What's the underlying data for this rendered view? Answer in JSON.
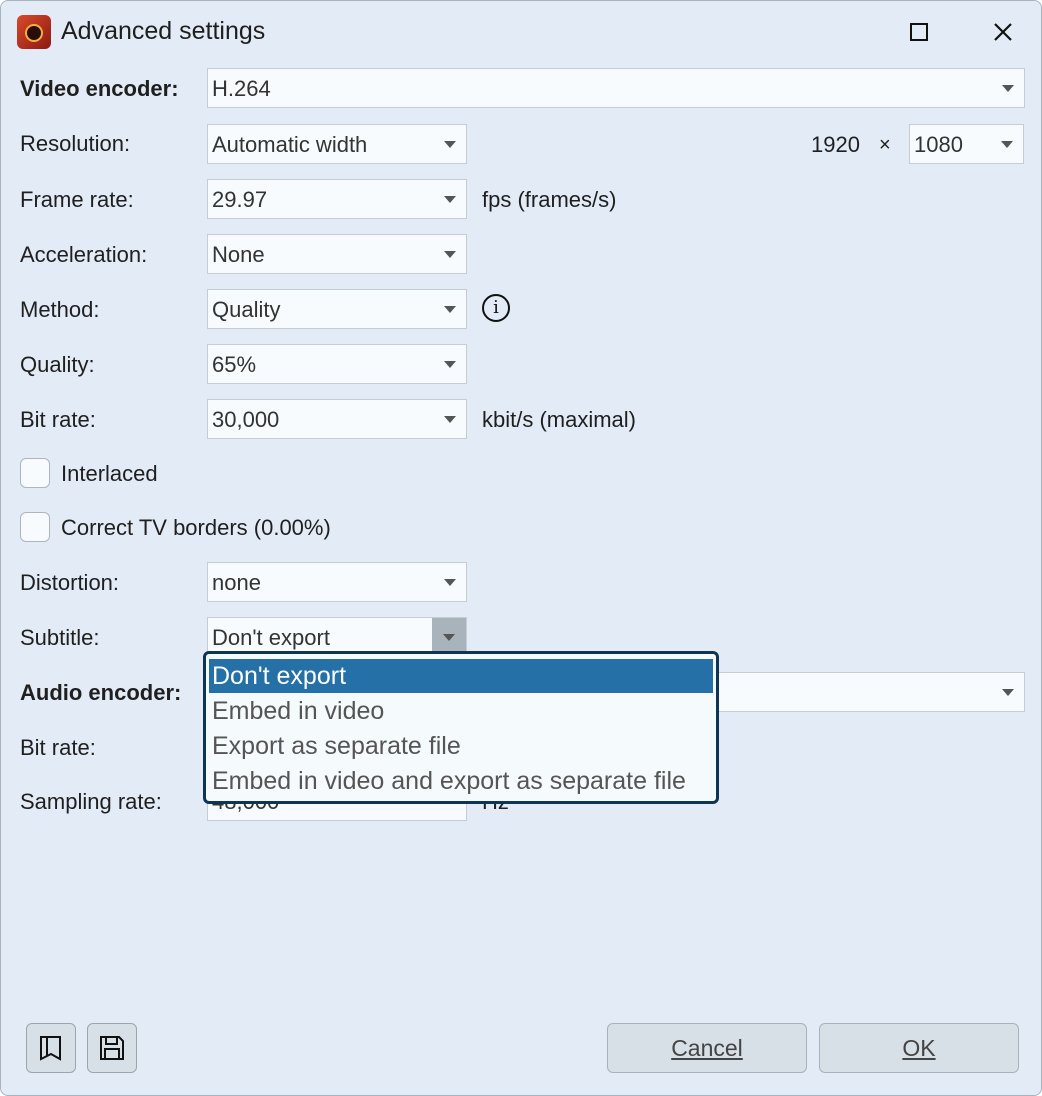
{
  "window": {
    "title": "Advanced settings"
  },
  "video": {
    "encoder_label": "Video encoder:",
    "encoder_value": "H.264",
    "resolution_label": "Resolution:",
    "resolution_value": "Automatic width",
    "width_value": "1920",
    "times": "×",
    "height_value": "1080",
    "framerate_label": "Frame rate:",
    "framerate_value": "29.97",
    "framerate_unit": "fps (frames/s)",
    "acceleration_label": "Acceleration:",
    "acceleration_value": "None",
    "method_label": "Method:",
    "method_value": "Quality",
    "quality_label": "Quality:",
    "quality_value": "65%",
    "bitrate_label": "Bit rate:",
    "bitrate_value": "30,000",
    "bitrate_unit": "kbit/s (maximal)",
    "interlaced_label": "Interlaced",
    "tvborders_label": "Correct TV borders (0.00%)",
    "distortion_label": "Distortion:",
    "distortion_value": "none",
    "subtitle_label": "Subtitle:",
    "subtitle_value": "Don't export"
  },
  "subtitle_options": [
    "Don't export",
    "Embed in video",
    "Export as separate file",
    "Embed in video and export as separate file"
  ],
  "audio": {
    "encoder_label": "Audio encoder:",
    "bitrate_label": "Bit rate:",
    "sampling_label": "Sampling rate:",
    "sampling_value": "48,000",
    "sampling_unit": "Hz"
  },
  "buttons": {
    "cancel": "Cancel",
    "ok": "OK"
  },
  "icons": {
    "info": "info-icon",
    "bookmark": "bookmark-icon",
    "save": "save-icon"
  }
}
